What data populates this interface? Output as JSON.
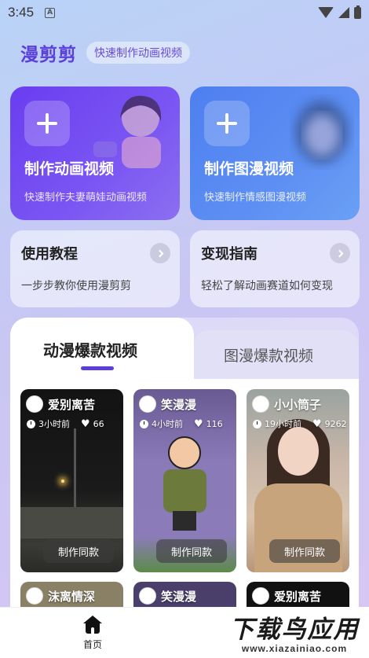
{
  "status_bar": {
    "time": "3:45",
    "notification_badge": "A",
    "icons": [
      "wifi-icon",
      "signal-icon",
      "battery-icon"
    ]
  },
  "header": {
    "title": "漫剪剪",
    "subtitle": "快速制作动画视频"
  },
  "cards": [
    {
      "title": "制作动画视频",
      "desc": "快速制作夫妻萌娃动画视频",
      "icon": "plus-icon"
    },
    {
      "title": "制作图漫视频",
      "desc": "快速制作情感图漫视频",
      "icon": "plus-icon"
    }
  ],
  "guides": [
    {
      "title": "使用教程",
      "desc": "一步步教你使用漫剪剪",
      "icon": "chevron-right-icon"
    },
    {
      "title": "变现指南",
      "desc": "轻松了解动画赛道如何变现",
      "icon": "chevron-right-icon"
    }
  ],
  "tabs": [
    {
      "label": "动漫爆款视频",
      "active": true
    },
    {
      "label": "图漫爆款视频",
      "active": false
    }
  ],
  "videos": [
    {
      "name": "爱别离苦",
      "time": "3小时前",
      "likes": "66",
      "button": "制作同款"
    },
    {
      "name": "笑漫漫",
      "time": "4小时前",
      "likes": "116",
      "button": "制作同款"
    },
    {
      "name": "小小筒子",
      "time": "19小时前",
      "likes": "9262",
      "button": "制作同款"
    }
  ],
  "videos_row2": [
    {
      "name": "沫离情深"
    },
    {
      "name": "笑漫漫"
    },
    {
      "name": "爱别离苦"
    }
  ],
  "bottom_nav": {
    "home_label": "首页"
  },
  "watermark": {
    "main": "下载鸟应用",
    "url": "www.xiazainiao.com"
  },
  "colors": {
    "brand": "#5b3fd8",
    "card_anim": "#6a3df0",
    "card_image": "#4e7ff0"
  }
}
